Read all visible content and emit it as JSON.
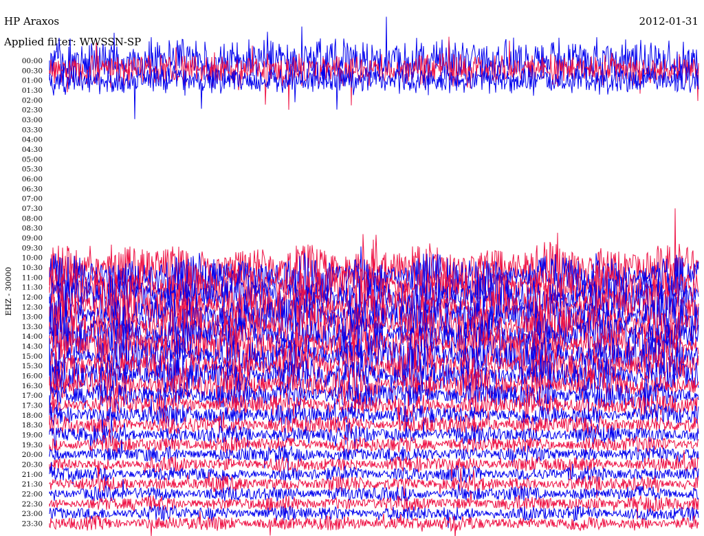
{
  "header": {
    "station": "HP Araxos",
    "date": "2012-01-31",
    "filter": "Applied filter: WWSSN-SP"
  },
  "chart_data": {
    "type": "line",
    "title": "HP Araxos",
    "subtitle": "Applied filter: WWSSN-SP",
    "date": "2012-01-31",
    "ylabel": "EHZ - 30000",
    "row_labels": [
      "00:00",
      "00:30",
      "01:00",
      "01:30",
      "02:00",
      "02:30",
      "03:00",
      "03:30",
      "04:00",
      "04:30",
      "05:00",
      "05:30",
      "06:00",
      "06:30",
      "07:00",
      "07:30",
      "08:00",
      "08:30",
      "09:00",
      "09:30",
      "10:00",
      "10:30",
      "11:00",
      "11:30",
      "12:00",
      "12:30",
      "13:00",
      "13:30",
      "14:00",
      "14:30",
      "15:00",
      "15:30",
      "16:00",
      "16:30",
      "17:00",
      "17:30",
      "18:00",
      "18:30",
      "19:00",
      "19:30",
      "20:00",
      "20:30",
      "21:00",
      "21:30",
      "22:00",
      "22:30",
      "23:00",
      "23:30"
    ],
    "series_colors": [
      "#0000ee",
      "#ee1144"
    ],
    "rows_with_data": [
      0,
      1,
      2,
      21,
      22,
      23,
      24,
      25,
      26,
      27,
      28,
      29,
      30,
      31,
      32,
      33,
      34,
      35,
      36,
      37,
      38,
      39,
      40,
      41,
      42,
      43,
      44,
      45,
      46,
      47
    ],
    "row_relative_amplitude": [
      0.55,
      0.35,
      0.25,
      0,
      0,
      0,
      0,
      0,
      0,
      0,
      0,
      0,
      0,
      0,
      0,
      0,
      0,
      0,
      0,
      0,
      0,
      1.0,
      1.0,
      0.95,
      0.95,
      0.9,
      0.9,
      0.85,
      0.85,
      0.8,
      0.75,
      0.7,
      0.65,
      0.55,
      0.45,
      0.35,
      0.28,
      0.22,
      0.18,
      0.15,
      0.12,
      0.1,
      0.1,
      0.1,
      0.09,
      0.09,
      0.09,
      0.08
    ],
    "grid": false
  }
}
